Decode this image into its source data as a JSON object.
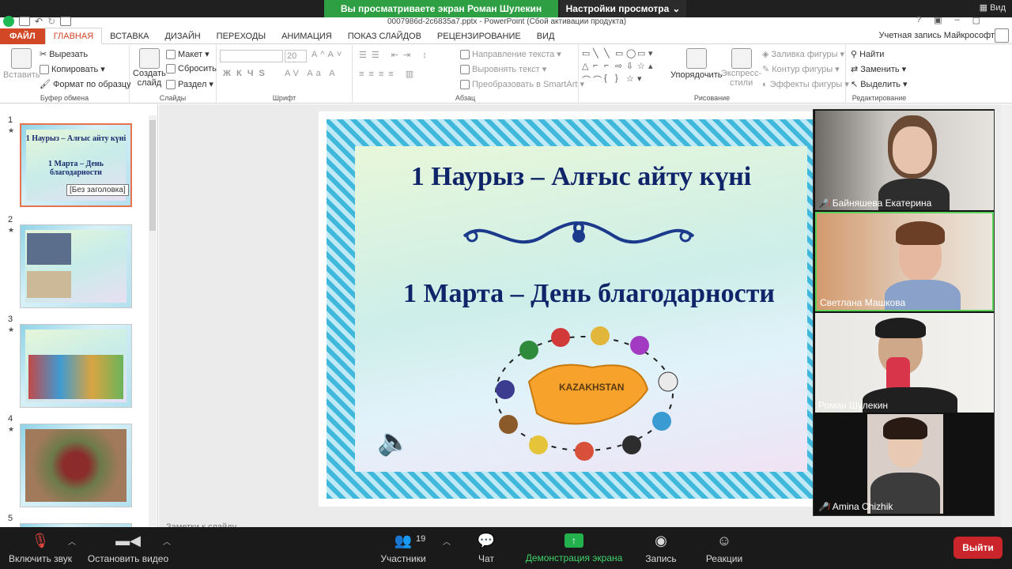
{
  "zoom_top": {
    "share_banner": "Вы просматриваете экран Роман Шулекин",
    "view_options": "Настройки просмотра",
    "view_label": "Вид"
  },
  "ppt": {
    "doc_title": "0007986d-2c6835a7.pptx - PowerPoint (Сбой активации продукта)",
    "tabs": [
      "ФАЙЛ",
      "ГЛАВНАЯ",
      "ВСТАВКА",
      "ДИЗАЙН",
      "ПЕРЕХОДЫ",
      "АНИМАЦИЯ",
      "ПОКАЗ СЛАЙДОВ",
      "РЕЦЕНЗИРОВАНИЕ",
      "ВИД"
    ],
    "active_tab": "ГЛАВНАЯ",
    "account": "Учетная запись Майкрософт",
    "ribbon": {
      "paste": "Вставить",
      "cut": "Вырезать",
      "copy": "Копировать",
      "format_painter": "Формат по образцу",
      "clipboard_group": "Буфер обмена",
      "new_slide_1": "Создать",
      "new_slide_2": "слайд",
      "layout": "Макет",
      "reset": "Сбросить",
      "section": "Раздел",
      "slides_group": "Слайды",
      "font_size": "20",
      "font_buttons": "Ж  К  Ч  S",
      "font_group": "Шрифт",
      "text_direction": "Направление текста",
      "align_text": "Выровнять текст",
      "smartart": "Преобразовать в SmartArt",
      "paragraph_group": "Абзац",
      "arrange": "Упорядочить",
      "quick_styles_1": "Экспресс-",
      "quick_styles_2": "стили",
      "shape_fill": "Заливка фигуры",
      "shape_outline": "Контур фигуры",
      "shape_effects": "Эффекты фигуры",
      "drawing_group": "Рисование",
      "find": "Найти",
      "replace": "Заменить",
      "select": "Выделить",
      "editing_group": "Редактирование"
    },
    "thumbnails": {
      "numbers": [
        "1",
        "2",
        "3",
        "4",
        "5"
      ],
      "slide1_line1": "1 Наурыз – Алғыс айту күні",
      "slide1_line2": "1 Марта – День благодарности",
      "tooltip": "[Без заголовка]"
    },
    "slide": {
      "title1": "1 Наурыз – Алғыс айту күні",
      "title2": "1 Марта – День благодарности",
      "map_label": "KAZAKHSTAN"
    },
    "notes_placeholder": "Заметки к слайду"
  },
  "participants": [
    {
      "name": "Байняшева Екатерина",
      "muted": true
    },
    {
      "name": "Светлана Машкова",
      "muted": false
    },
    {
      "name": "Роман Шулекин",
      "muted": false
    },
    {
      "name": "Amina Chizhik",
      "muted": true
    }
  ],
  "toolbar": {
    "audio": "Включить звук",
    "video": "Остановить видео",
    "participants": "Участники",
    "participants_count": "19",
    "chat": "Чат",
    "share": "Демонстрация экрана",
    "record": "Запись",
    "reactions": "Реакции",
    "leave": "Выйти"
  },
  "colors": {
    "share_green": "#2ea043",
    "ppt_accent": "#d24726",
    "slide_title": "#10246a",
    "leave_red": "#c9252b"
  }
}
